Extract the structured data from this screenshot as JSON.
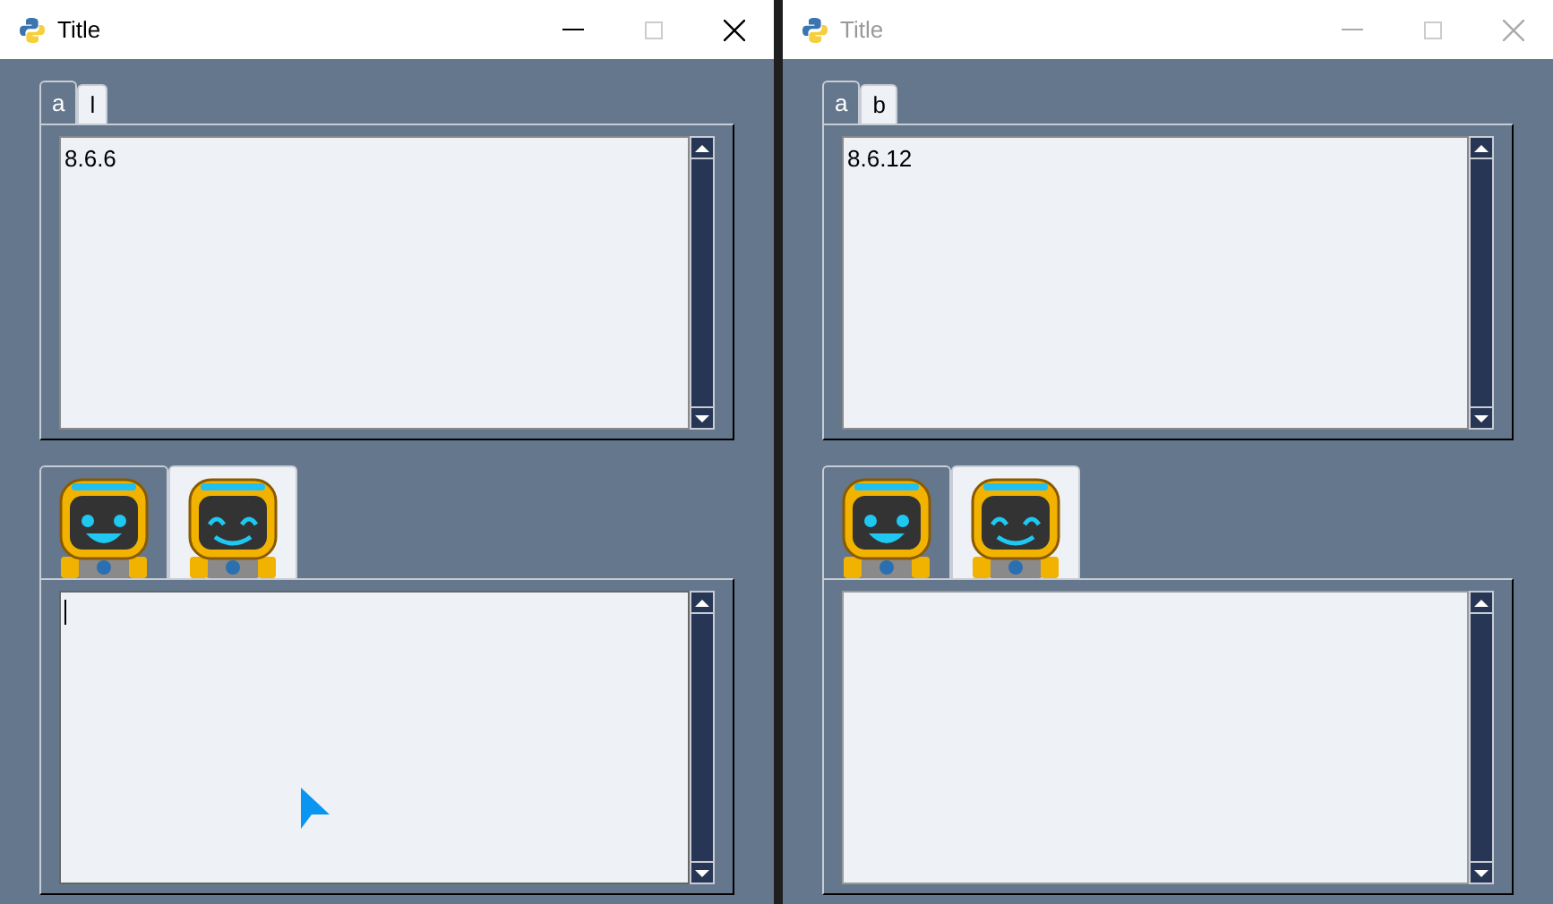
{
  "windows": [
    {
      "title": "Title",
      "active": true,
      "top_tabs": [
        {
          "label": "a",
          "selected": true
        },
        {
          "label": "l",
          "selected": false
        }
      ],
      "top_text": "8.6.6",
      "image_tabs": [
        {
          "kind": "open-eyes",
          "selected": true
        },
        {
          "kind": "closed-eyes",
          "selected": false
        }
      ],
      "bottom_focused": true,
      "pointer": true
    },
    {
      "title": "Title",
      "active": false,
      "top_tabs": [
        {
          "label": "a",
          "selected": true
        },
        {
          "label": "b",
          "selected": false
        }
      ],
      "top_text": "8.6.12",
      "image_tabs": [
        {
          "kind": "open-eyes",
          "selected": true
        },
        {
          "kind": "closed-eyes",
          "selected": false
        }
      ],
      "bottom_focused": false,
      "pointer": false
    }
  ]
}
